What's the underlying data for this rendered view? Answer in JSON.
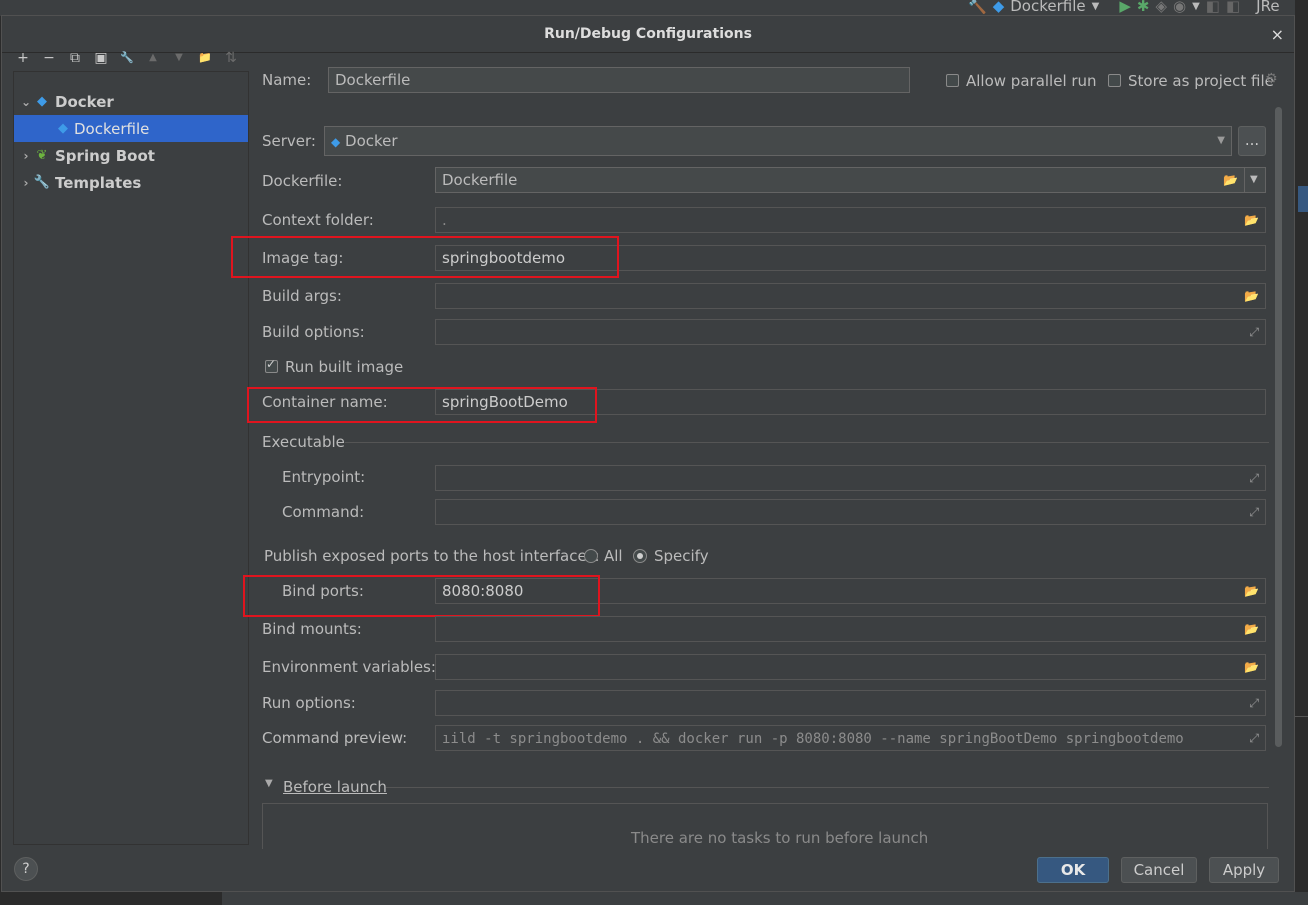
{
  "ide": {
    "run_config": "Dockerfile",
    "user_fragment": "JRe"
  },
  "dialog": {
    "title": "Run/Debug Configurations",
    "close_symbol": "×"
  },
  "toolbar": {
    "add": "+",
    "remove": "−",
    "copy": "⧉",
    "save": "▣",
    "edit": "🔧",
    "up": "▲",
    "down": "▼",
    "folder": "📁",
    "sort": "⇅"
  },
  "tree": {
    "items": [
      {
        "label": "Docker",
        "icon": "docker-icon",
        "expanded": true
      },
      {
        "label": "Dockerfile",
        "icon": "docker-icon",
        "selected": true
      },
      {
        "label": "Spring Boot",
        "icon": "spring-boot-icon"
      },
      {
        "label": "Templates",
        "icon": "wrench-icon"
      }
    ]
  },
  "form": {
    "name_label": "Name:",
    "name_value": "Dockerfile",
    "allow_parallel_label": "Allow parallel run",
    "store_project_label": "Store as project file",
    "server_label": "Server:",
    "server_value": "Docker",
    "more_button": "...",
    "dockerfile_label": "Dockerfile:",
    "dockerfile_value": "Dockerfile",
    "context_label": "Context folder:",
    "context_value": ".",
    "image_tag_label": "Image tag:",
    "image_tag_value": "springbootdemo",
    "build_args_label": "Build args:",
    "build_args_value": "",
    "build_options_label": "Build options:",
    "build_options_value": "",
    "run_built_label": "Run built image",
    "run_built_checked": true,
    "container_name_label": "Container name:",
    "container_name_value": "springBootDemo",
    "executable_label": "Executable",
    "entrypoint_label": "Entrypoint:",
    "entrypoint_value": "",
    "command_label": "Command:",
    "command_value": "",
    "publish_label": "Publish exposed ports to the host interfaces:",
    "publish_all_label": "All",
    "publish_specify_label": "Specify",
    "publish_selected": "Specify",
    "bind_ports_label": "Bind ports:",
    "bind_ports_value": "8080:8080",
    "bind_mounts_label": "Bind mounts:",
    "bind_mounts_value": "",
    "env_label": "Environment variables:",
    "env_value": "",
    "run_options_label": "Run options:",
    "run_options_value": "",
    "preview_label": "Command preview:",
    "preview_value": "ıild -t springbootdemo . && docker run -p 8080:8080 --name springBootDemo springbootdemo",
    "before_launch_label": "Before launch",
    "before_launch_empty": "There are no tasks to run before launch"
  },
  "buttons": {
    "ok": "OK",
    "cancel": "Cancel",
    "apply": "Apply",
    "help": "?"
  },
  "colors": {
    "background": "#3c3f41",
    "selection": "#2f65ca",
    "highlight_box": "#e0141e",
    "primary_button": "#365880"
  }
}
